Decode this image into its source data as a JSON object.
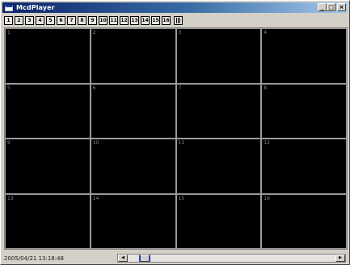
{
  "window": {
    "title": "McdPlayer",
    "caption_buttons": [
      "_",
      "□",
      "×"
    ]
  },
  "toolbar": {
    "channel_buttons": [
      "1",
      "2",
      "3",
      "4",
      "5",
      "6",
      "7",
      "8",
      "9",
      "10",
      "11",
      "12",
      "13",
      "14",
      "15",
      "16"
    ],
    "layout_icon": "grid-layout-icon"
  },
  "video_grid": {
    "cells": [
      "1",
      "2",
      "3",
      "4",
      "5",
      "6",
      "7",
      "8",
      "9",
      "10",
      "11",
      "12",
      "13",
      "14",
      "15",
      "16"
    ]
  },
  "status": {
    "timestamp": "2005/04/21 13:18:48"
  },
  "scrollbar": {
    "left_arrow": "◀",
    "right_arrow": "▶"
  },
  "colors": {
    "title_gradient_start": "#0a246a",
    "title_gradient_end": "#a6caf0",
    "video_background": "#000000",
    "grid_lines": "#9a9a9a",
    "chrome": "#d4d0c8"
  }
}
